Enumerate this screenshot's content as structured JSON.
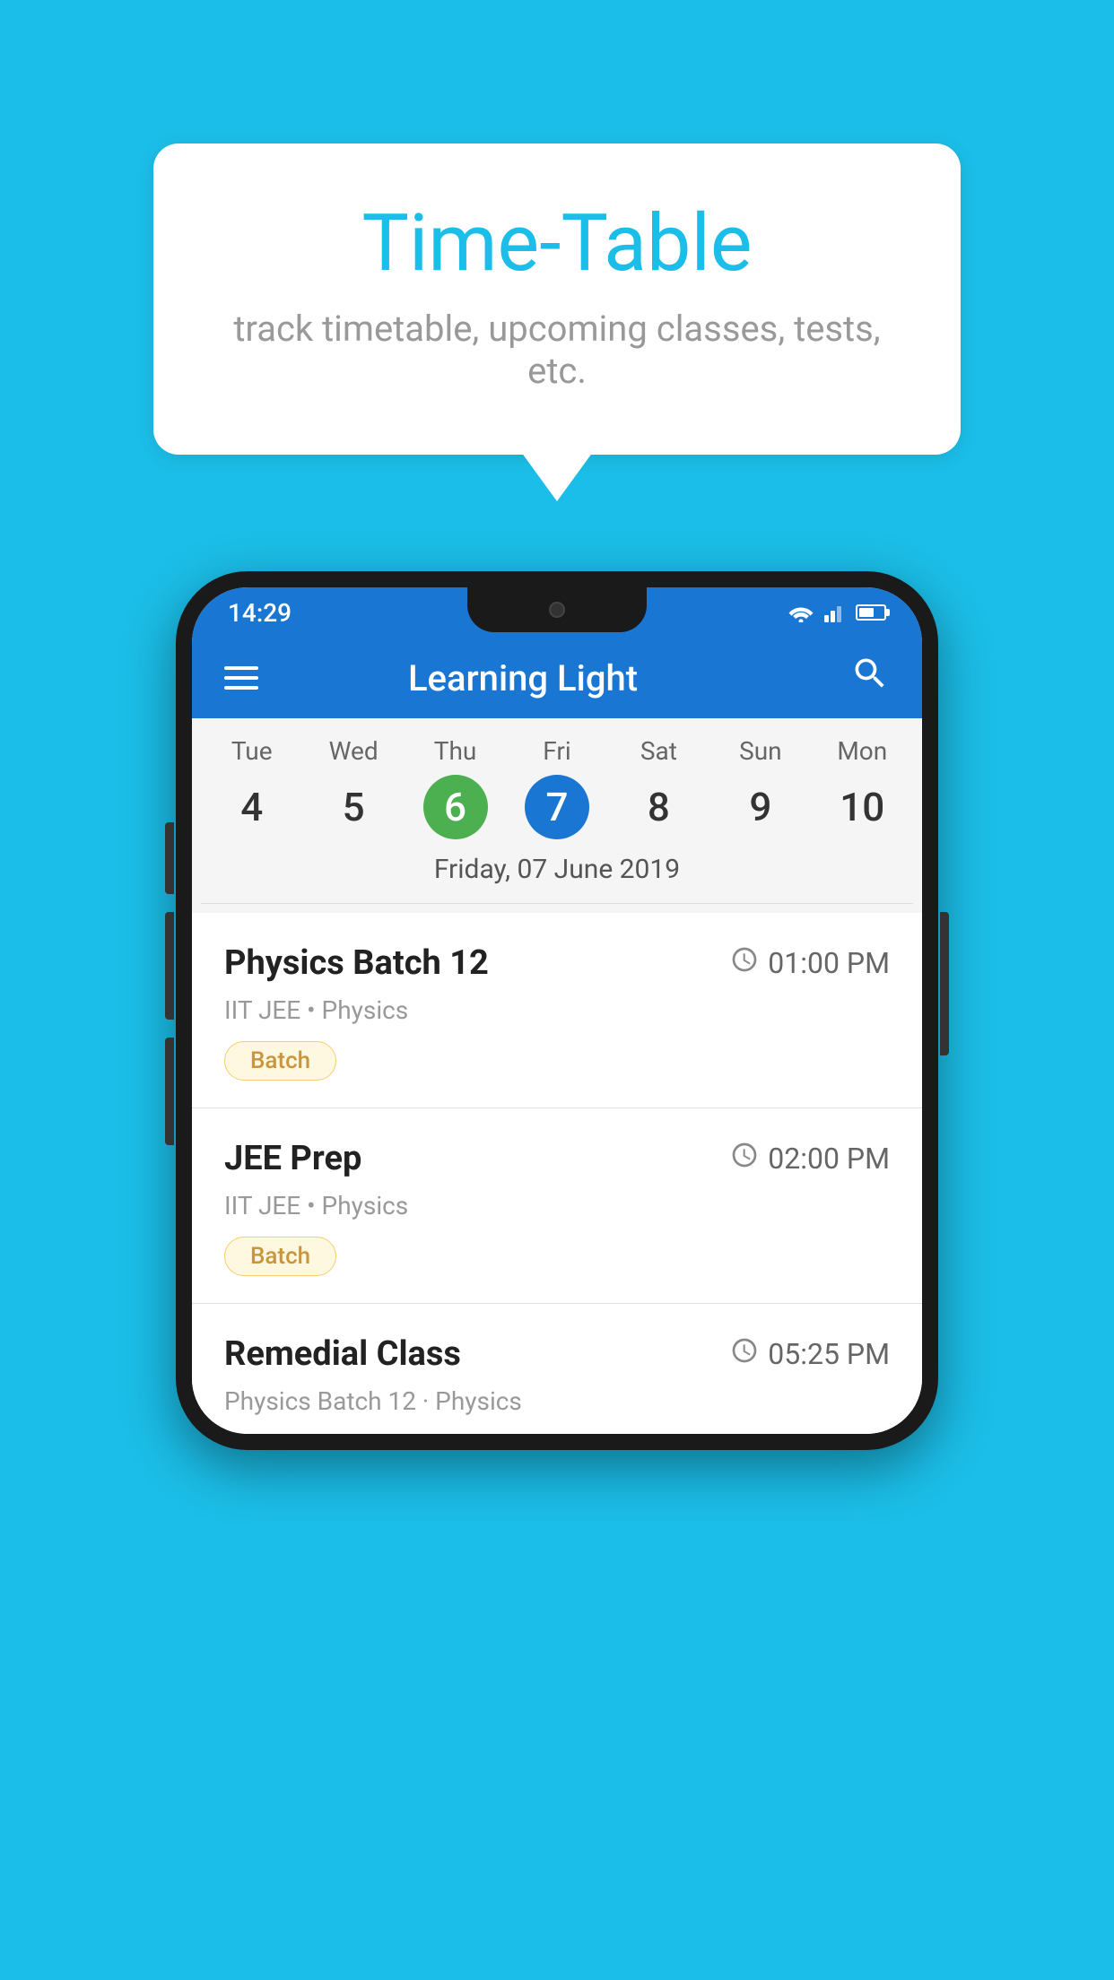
{
  "background_color": "#1bbee8",
  "speech_bubble": {
    "title": "Time-Table",
    "subtitle": "track timetable, upcoming classes, tests, etc."
  },
  "phone": {
    "status_bar": {
      "time": "14:29"
    },
    "app_bar": {
      "title": "Learning Light"
    },
    "calendar": {
      "days": [
        {
          "label": "Tue",
          "number": "4"
        },
        {
          "label": "Wed",
          "number": "5"
        },
        {
          "label": "Thu",
          "number": "6",
          "state": "today"
        },
        {
          "label": "Fri",
          "number": "7",
          "state": "selected"
        },
        {
          "label": "Sat",
          "number": "8"
        },
        {
          "label": "Sun",
          "number": "9"
        },
        {
          "label": "Mon",
          "number": "10"
        }
      ],
      "selected_date": "Friday, 07 June 2019"
    },
    "schedule": [
      {
        "title": "Physics Batch 12",
        "time": "01:00 PM",
        "meta": "IIT JEE • Physics",
        "tag": "Batch"
      },
      {
        "title": "JEE Prep",
        "time": "02:00 PM",
        "meta": "IIT JEE • Physics",
        "tag": "Batch"
      },
      {
        "title": "Remedial Class",
        "time": "05:25 PM",
        "meta": "Physics Batch 12 · Physics",
        "tag": null
      }
    ]
  }
}
